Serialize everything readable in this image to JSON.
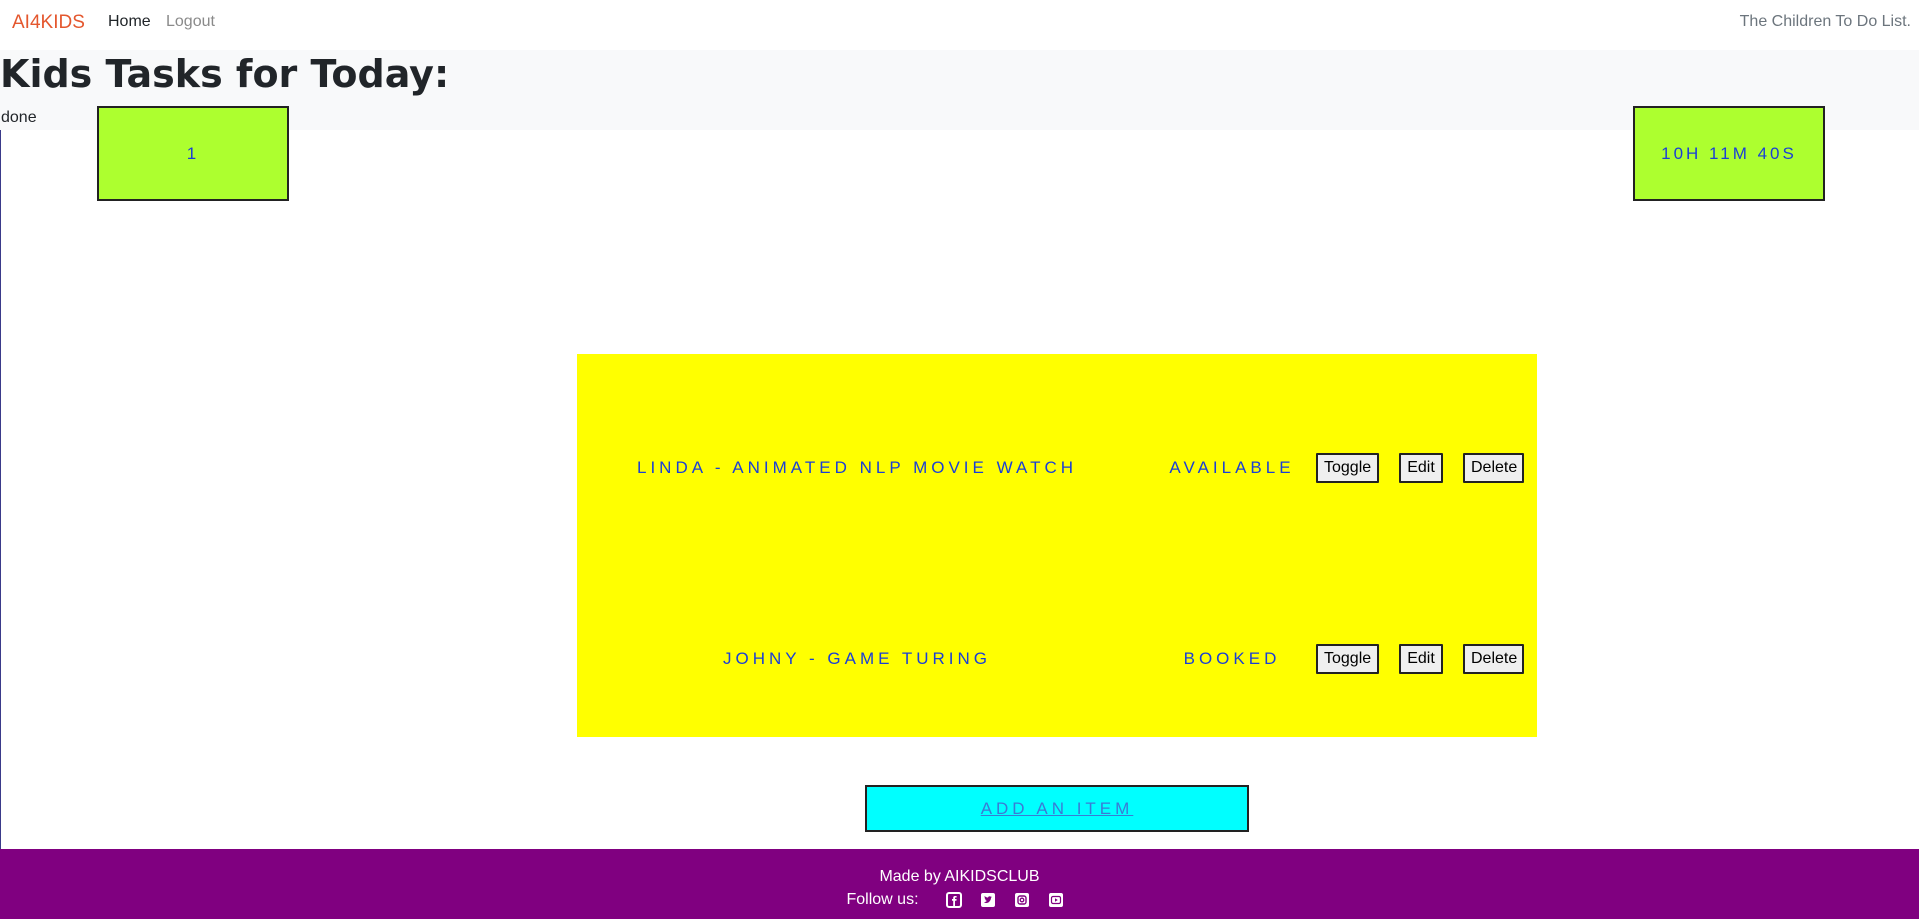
{
  "navbar": {
    "brand": "AI4KIDS",
    "links": [
      "Home",
      "Logout"
    ],
    "right_text": "The Children To Do List."
  },
  "page": {
    "title": "Kids Tasks for Today:",
    "done_label": "done",
    "done_count": "1",
    "timer": "10h 11m 40s"
  },
  "tasks": [
    {
      "title": "Linda - Animated NLP Movie Watch",
      "status": "Available"
    },
    {
      "title": "Johny - Game Turing",
      "status": "Booked"
    }
  ],
  "task_buttons": {
    "toggle": "Toggle",
    "edit": "Edit",
    "delete": "Delete"
  },
  "add_item_label": "Add an item",
  "footer": {
    "made_by": "Made by AIKIDSCLUB",
    "follow_label": "Follow us:",
    "social_icons": [
      "facebook-icon",
      "twitter-icon",
      "instagram-icon",
      "youtube-icon"
    ]
  },
  "colors": {
    "brand": "#e4572e",
    "green_box": "#adff2f",
    "task_panel": "#ffff00",
    "add_button": "#00ffff",
    "footer": "#800080",
    "task_text": "#1a3fd6"
  }
}
